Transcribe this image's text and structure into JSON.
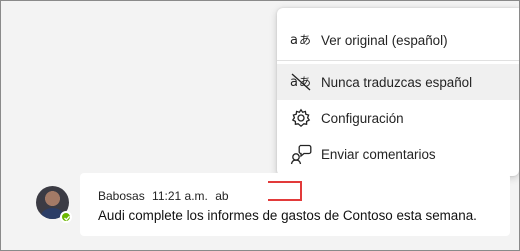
{
  "menu": {
    "items": [
      {
        "label": "Ver original (español)",
        "icon": "translate-icon"
      },
      {
        "label": "Nunca traduzcas español",
        "icon": "translate-off-icon"
      },
      {
        "label": "Configuración",
        "icon": "gear-icon"
      },
      {
        "label": "Enviar comentarios",
        "icon": "feedback-icon"
      }
    ]
  },
  "message": {
    "sender": "Babosas",
    "time": "11:21 a.m.",
    "tag": "ab",
    "text": "Audi complete los informes de gastos de Contoso esta semana."
  },
  "colors": {
    "presence": "#6bb700",
    "highlight": "#e23a3a"
  }
}
